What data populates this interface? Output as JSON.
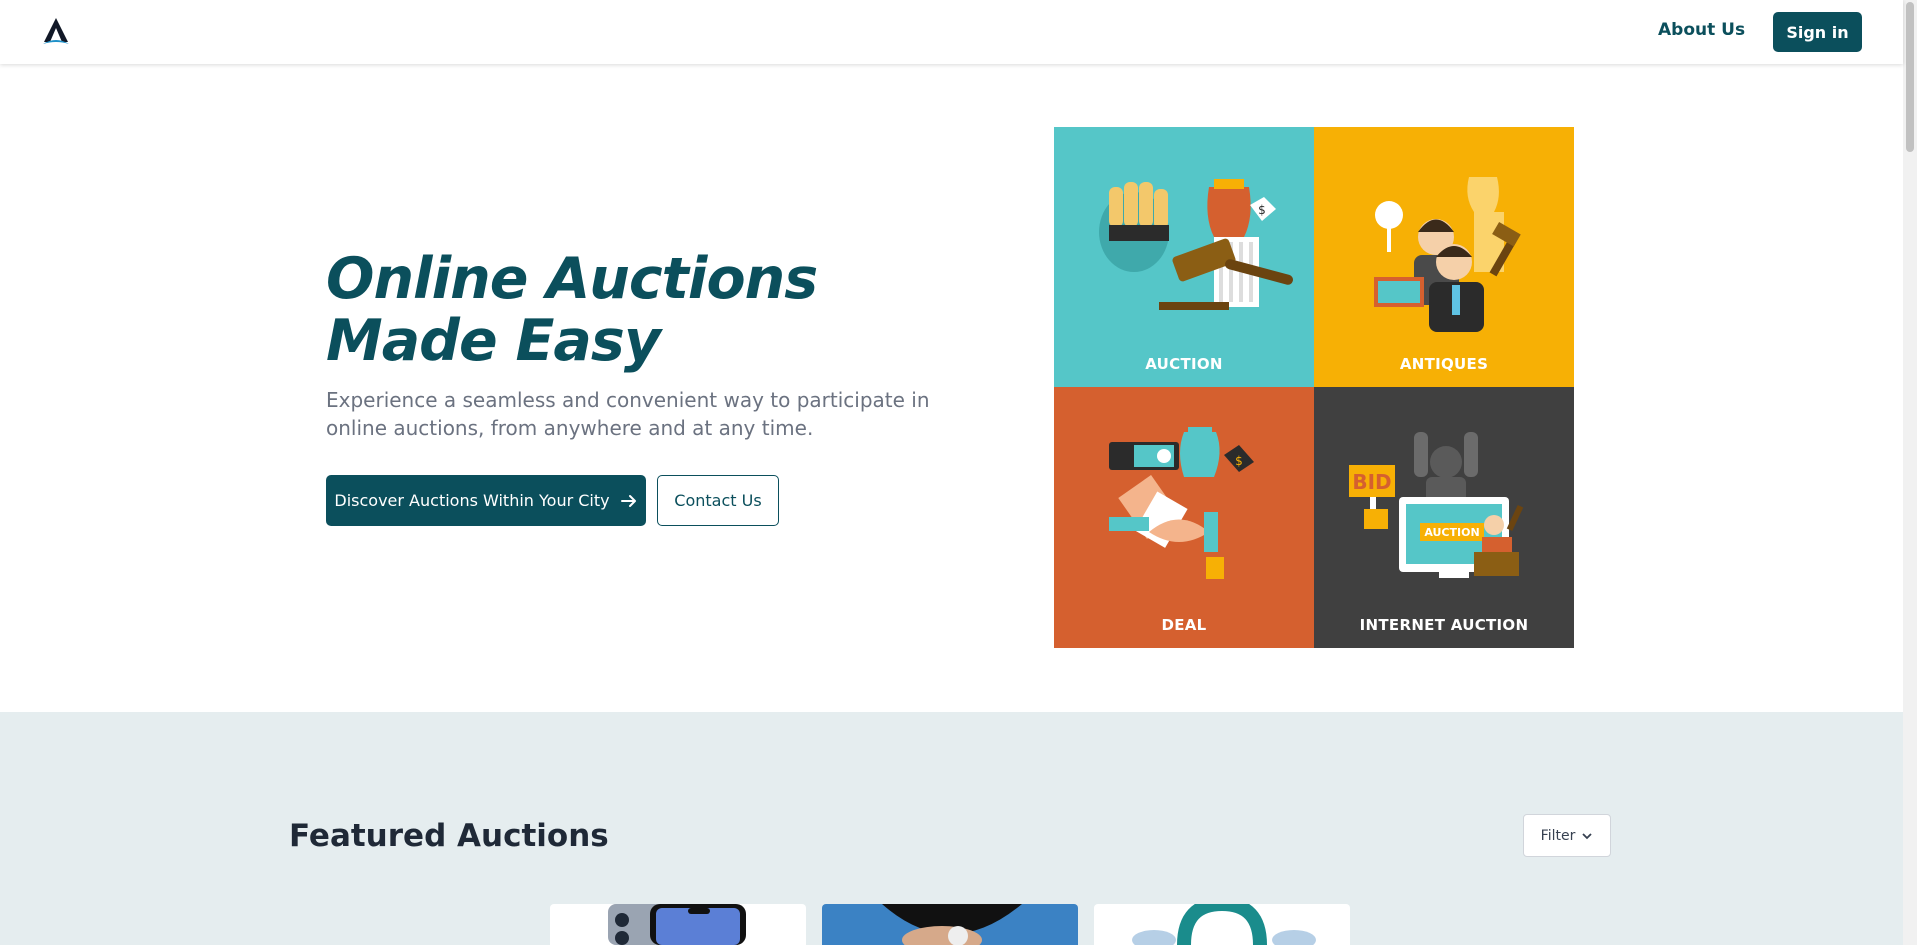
{
  "nav": {
    "about_label": "About Us",
    "signin_label": "Sign in"
  },
  "hero": {
    "title": "Online Auctions Made Easy",
    "subtitle": "Experience a seamless and convenient way to participate in online auctions, from anywhere and at any time.",
    "primary_cta": "Discover Auctions Within Your City",
    "secondary_cta": "Contact Us"
  },
  "tiles": [
    {
      "label": "AUCTION",
      "color": "#55c6c8"
    },
    {
      "label": "ANTIQUES",
      "color": "#f7b005"
    },
    {
      "label": "DEAL",
      "color": "#d5602f"
    },
    {
      "label": "INTERNET AUCTION",
      "color": "#404040"
    }
  ],
  "tile_badges": {
    "bid": "BID",
    "auction": "AUCTION"
  },
  "featured": {
    "title": "Featured Auctions",
    "filter_label": "Filter"
  },
  "colors": {
    "brand": "#0b4f5c",
    "featured_bg": "#e5edef"
  }
}
